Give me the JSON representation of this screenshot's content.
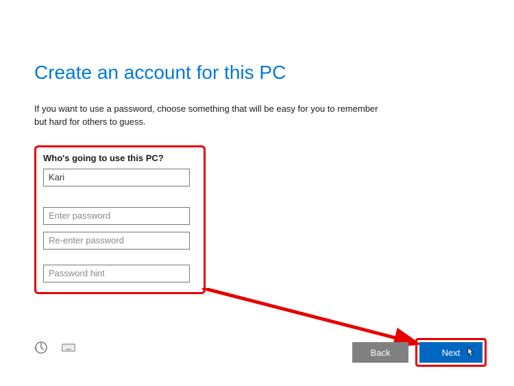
{
  "title": "Create an account for this PC",
  "description": "If you want to use a password, choose something that will be easy for you to remember but hard for others to guess.",
  "form": {
    "question": "Who's going to use this PC?",
    "username_value": "Kari",
    "password_placeholder": "Enter password",
    "repassword_placeholder": "Re-enter password",
    "hint_placeholder": "Password hint"
  },
  "buttons": {
    "back": "Back",
    "next": "Next"
  },
  "colors": {
    "accent": "#0078d7",
    "highlight": "#e60000",
    "primary_button": "#0067c0",
    "secondary_button": "#808080"
  }
}
